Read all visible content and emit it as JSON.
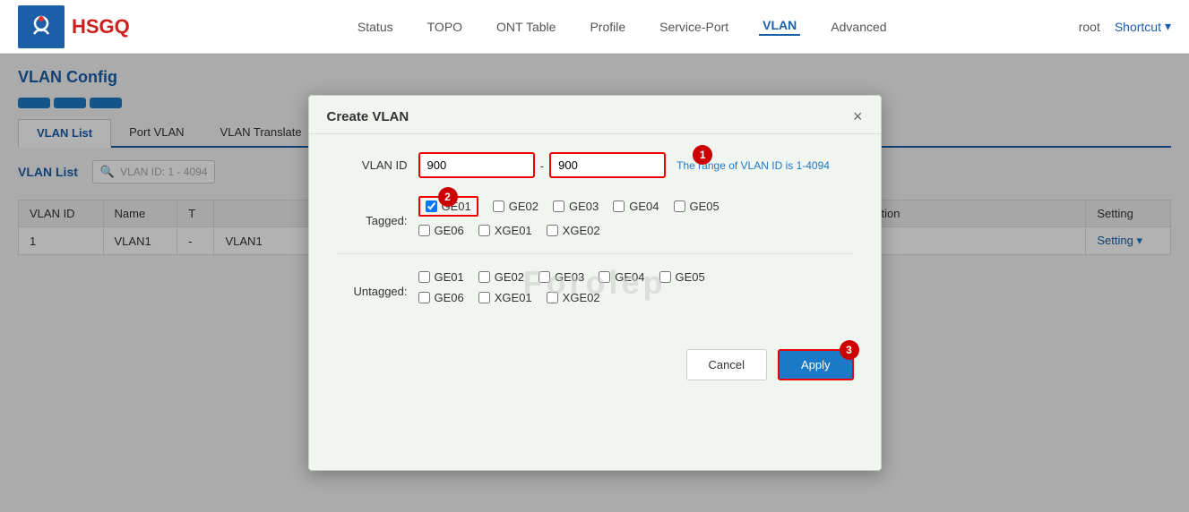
{
  "header": {
    "brand": "HSGQ",
    "nav": {
      "items": [
        {
          "label": "Status",
          "active": false
        },
        {
          "label": "TOPO",
          "active": false
        },
        {
          "label": "ONT Table",
          "active": false
        },
        {
          "label": "Profile",
          "active": false
        },
        {
          "label": "Service-Port",
          "active": false
        },
        {
          "label": "VLAN",
          "active": true
        },
        {
          "label": "Advanced",
          "active": false
        }
      ],
      "root": "root",
      "shortcut": "Shortcut"
    }
  },
  "page": {
    "title": "VLAN Config",
    "sub_tabs": [
      {
        "label": "VLAN List",
        "active": true
      },
      {
        "label": "Port VLAN",
        "active": false
      },
      {
        "label": "VLAN Translate",
        "active": false
      }
    ],
    "vlan_list_label": "VLAN List",
    "search_placeholder": "VLAN ID: 1 - 4094",
    "table": {
      "columns": [
        "VLAN ID",
        "Name",
        "T",
        "Description",
        "Setting"
      ],
      "rows": [
        {
          "vlan_id": "1",
          "name": "VLAN1",
          "t": "-",
          "description": "VLAN1",
          "setting": "Setting"
        }
      ]
    }
  },
  "dialog": {
    "title": "Create VLAN",
    "close_label": "×",
    "vlan_id_label": "VLAN ID",
    "vlan_id_from": "900",
    "vlan_id_to": "900",
    "vlan_id_separator": "-",
    "vlan_id_hint": "The range of VLAN ID is 1-4094",
    "tagged_label": "Tagged:",
    "untagged_label": "Untagged:",
    "tagged_ports": [
      {
        "id": "ge01_tag",
        "label": "GE01",
        "checked": true,
        "highlighted": true
      },
      {
        "id": "ge02_tag",
        "label": "GE02",
        "checked": false
      },
      {
        "id": "ge03_tag",
        "label": "GE03",
        "checked": false
      },
      {
        "id": "ge04_tag",
        "label": "GE04",
        "checked": false
      },
      {
        "id": "ge05_tag",
        "label": "GE05",
        "checked": false
      }
    ],
    "tagged_ports_row2": [
      {
        "id": "ge06_tag",
        "label": "GE06",
        "checked": false
      },
      {
        "id": "xge01_tag",
        "label": "XGE01",
        "checked": false
      },
      {
        "id": "xge02_tag",
        "label": "XGE02",
        "checked": false
      }
    ],
    "untagged_ports": [
      {
        "id": "ge01_untag",
        "label": "GE01",
        "checked": false
      },
      {
        "id": "ge02_untag",
        "label": "GE02",
        "checked": false
      },
      {
        "id": "ge03_untag",
        "label": "GE03",
        "checked": false
      },
      {
        "id": "ge04_untag",
        "label": "GE04",
        "checked": false
      },
      {
        "id": "ge05_untag",
        "label": "GE05",
        "checked": false
      }
    ],
    "untagged_ports_row2": [
      {
        "id": "ge06_untag",
        "label": "GE06",
        "checked": false
      },
      {
        "id": "xge01_untag",
        "label": "XGE01",
        "checked": false
      },
      {
        "id": "xge02_untag",
        "label": "XGE02",
        "checked": false
      }
    ],
    "cancel_label": "Cancel",
    "apply_label": "Apply",
    "badges": [
      {
        "number": "1",
        "position": "vlan-id"
      },
      {
        "number": "2",
        "position": "tagged-ge01"
      },
      {
        "number": "3",
        "position": "apply-btn"
      }
    ]
  }
}
